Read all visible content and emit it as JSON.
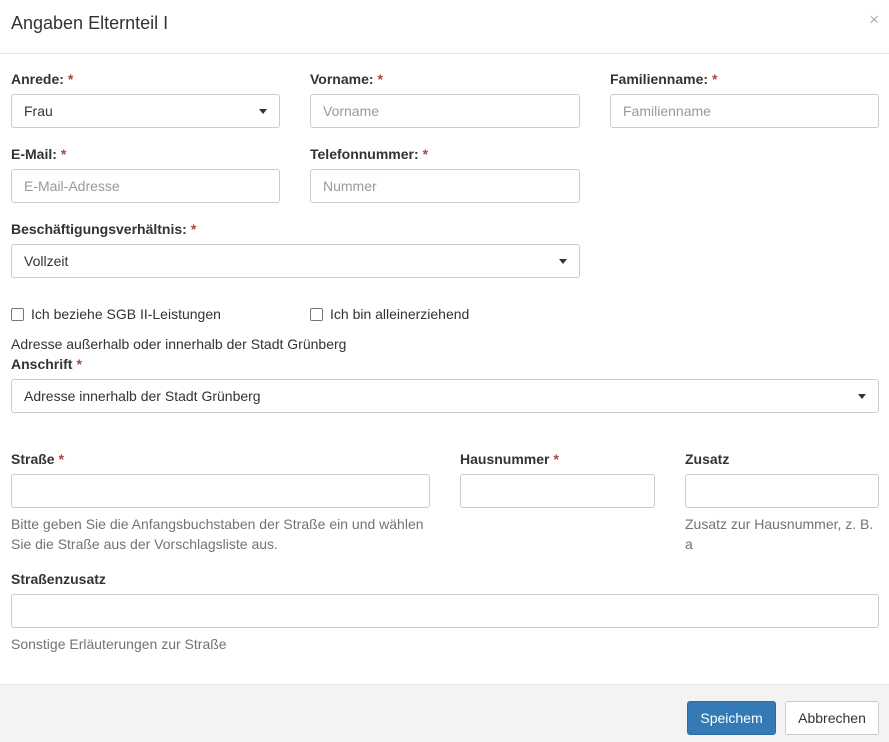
{
  "modal": {
    "title": "Angaben Elternteil I",
    "close": "×"
  },
  "required_marker": "*",
  "fields": {
    "anrede": {
      "label": "Anrede:",
      "value": "Frau"
    },
    "vorname": {
      "label": "Vorname:",
      "placeholder": "Vorname"
    },
    "familienname": {
      "label": "Familienname:",
      "placeholder": "Familienname"
    },
    "email": {
      "label": "E-Mail:",
      "placeholder": "E-Mail-Adresse"
    },
    "telefon": {
      "label": "Telefonnummer:",
      "placeholder": "Nummer"
    },
    "beschaeftigung": {
      "label": "Beschäftigungsverhältnis:",
      "value": "Vollzeit"
    },
    "sgb": {
      "label": "Ich beziehe SGB II-Leistungen",
      "checked": false
    },
    "alleinerziehend": {
      "label": "Ich bin alleinerziehend",
      "checked": false
    },
    "adresse_hinweis": "Adresse außerhalb oder innerhalb der Stadt Grünberg",
    "anschrift": {
      "label": "Anschrift",
      "value": "Adresse innerhalb der Stadt Grünberg"
    },
    "strasse": {
      "label": "Straße",
      "value": "",
      "help_line1": "Bitte geben Sie die Anfangsbuchstaben der Straße ein und wählen",
      "help_line2": "Sie die Straße aus der Vorschlagsliste aus."
    },
    "hausnummer": {
      "label": "Hausnummer",
      "value": ""
    },
    "zusatz": {
      "label": "Zusatz",
      "value": "",
      "help_line1": "Zusatz zur Hausnummer, z. B.",
      "help_line2": "a"
    },
    "strassenzusatz": {
      "label": "Straßenzusatz",
      "value": "",
      "help": "Sonstige Erläuterungen zur Straße"
    }
  },
  "footer": {
    "save_label": "Speichem",
    "cancel_label": "Abbrechen"
  },
  "colors": {
    "primary": "#337ab7",
    "required": "#a94442",
    "footer_bg": "#f3f3f3"
  }
}
